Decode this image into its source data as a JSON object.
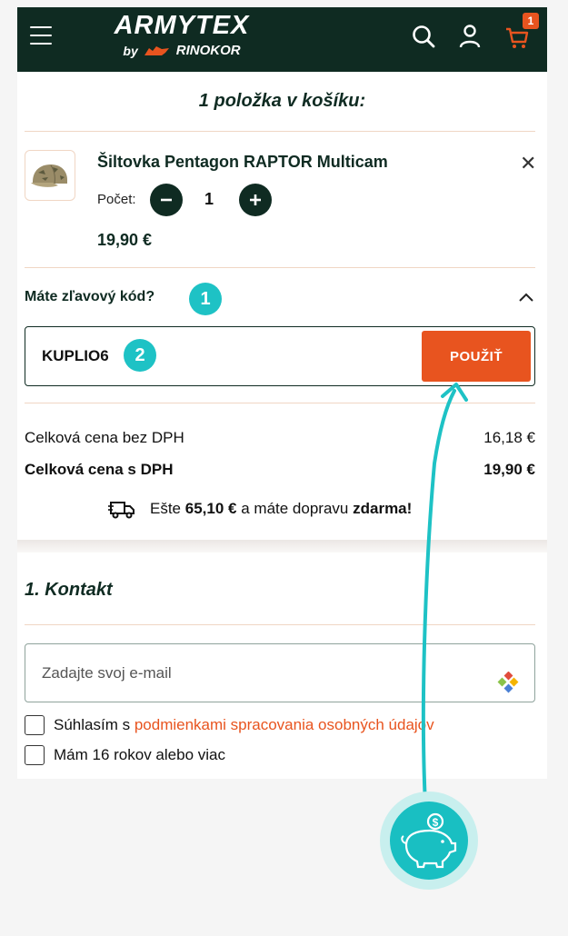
{
  "header": {
    "brand_title": "ARMYTEX",
    "brand_by": "by",
    "brand_name": "RINOKOR",
    "cart_count": "1"
  },
  "cart": {
    "title": "1 položka v košíku:",
    "item": {
      "name": "Šiltovka Pentagon RAPTOR Multicam",
      "qty_label": "Počet:",
      "qty": "1",
      "price": "19,90 €"
    }
  },
  "discount": {
    "label": "Máte zľavový kód?",
    "step1": "1",
    "code": "KUPLIO6",
    "step2": "2",
    "apply_label": "POUŽIŤ"
  },
  "summary": {
    "without_vat_label": "Celková cena bez DPH",
    "without_vat_value": "16,18 €",
    "with_vat_label": "Celková cena s DPH",
    "with_vat_value": "19,90 €"
  },
  "shipping": {
    "prefix": "Ešte",
    "amount": "65,10 €",
    "middle": "a máte dopravu",
    "free": "zdarma",
    "suffix": "!"
  },
  "contact": {
    "heading": "1. Kontakt",
    "email_placeholder": "Zadajte svoj e-mail",
    "consent_prefix": "Súhlasím s",
    "consent_link": "podmienkami spracovania osobných údajov",
    "age_label": "Mám 16 rokov alebo viac"
  },
  "colors": {
    "header_bg": "#0f2b22",
    "accent_orange": "#e8541f",
    "teal": "#1ec2c5"
  }
}
